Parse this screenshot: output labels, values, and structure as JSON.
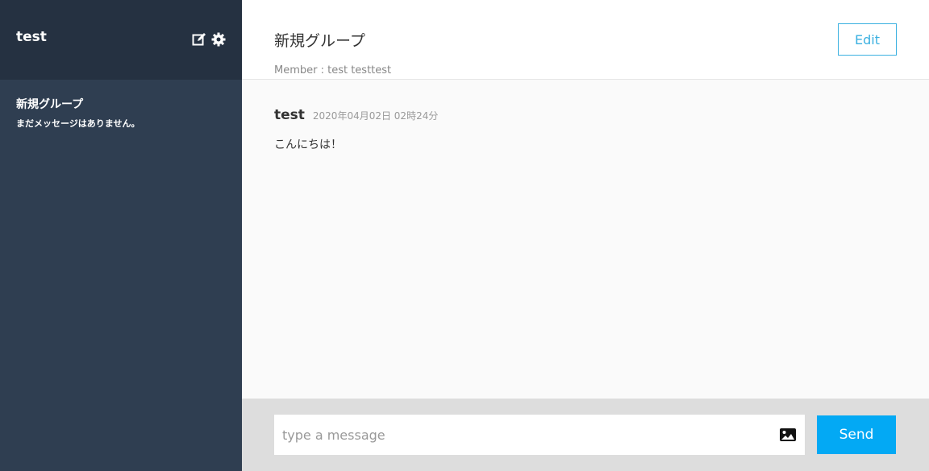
{
  "sidebar": {
    "user_name": "test",
    "icons": [
      "edit-icon",
      "gear-icon"
    ],
    "groups": [
      {
        "name": "新規グループ",
        "latest": "まだメッセージはありません。"
      }
    ]
  },
  "main": {
    "group_title": "新規グループ",
    "member_line": "Member : test testtest",
    "edit_label": "Edit",
    "messages": [
      {
        "user": "test",
        "date": "2020年04月02日 02時24分",
        "text": "こんにちは！"
      }
    ]
  },
  "form": {
    "placeholder": "type a message",
    "value": "",
    "image_icon": "image-icon",
    "send_label": "Send"
  },
  "colors": {
    "sidebar_bg": "#2f3e51",
    "sidebar_header_bg": "#253141",
    "accent": "#03a9f4",
    "edit_border": "#3ab0e0"
  }
}
